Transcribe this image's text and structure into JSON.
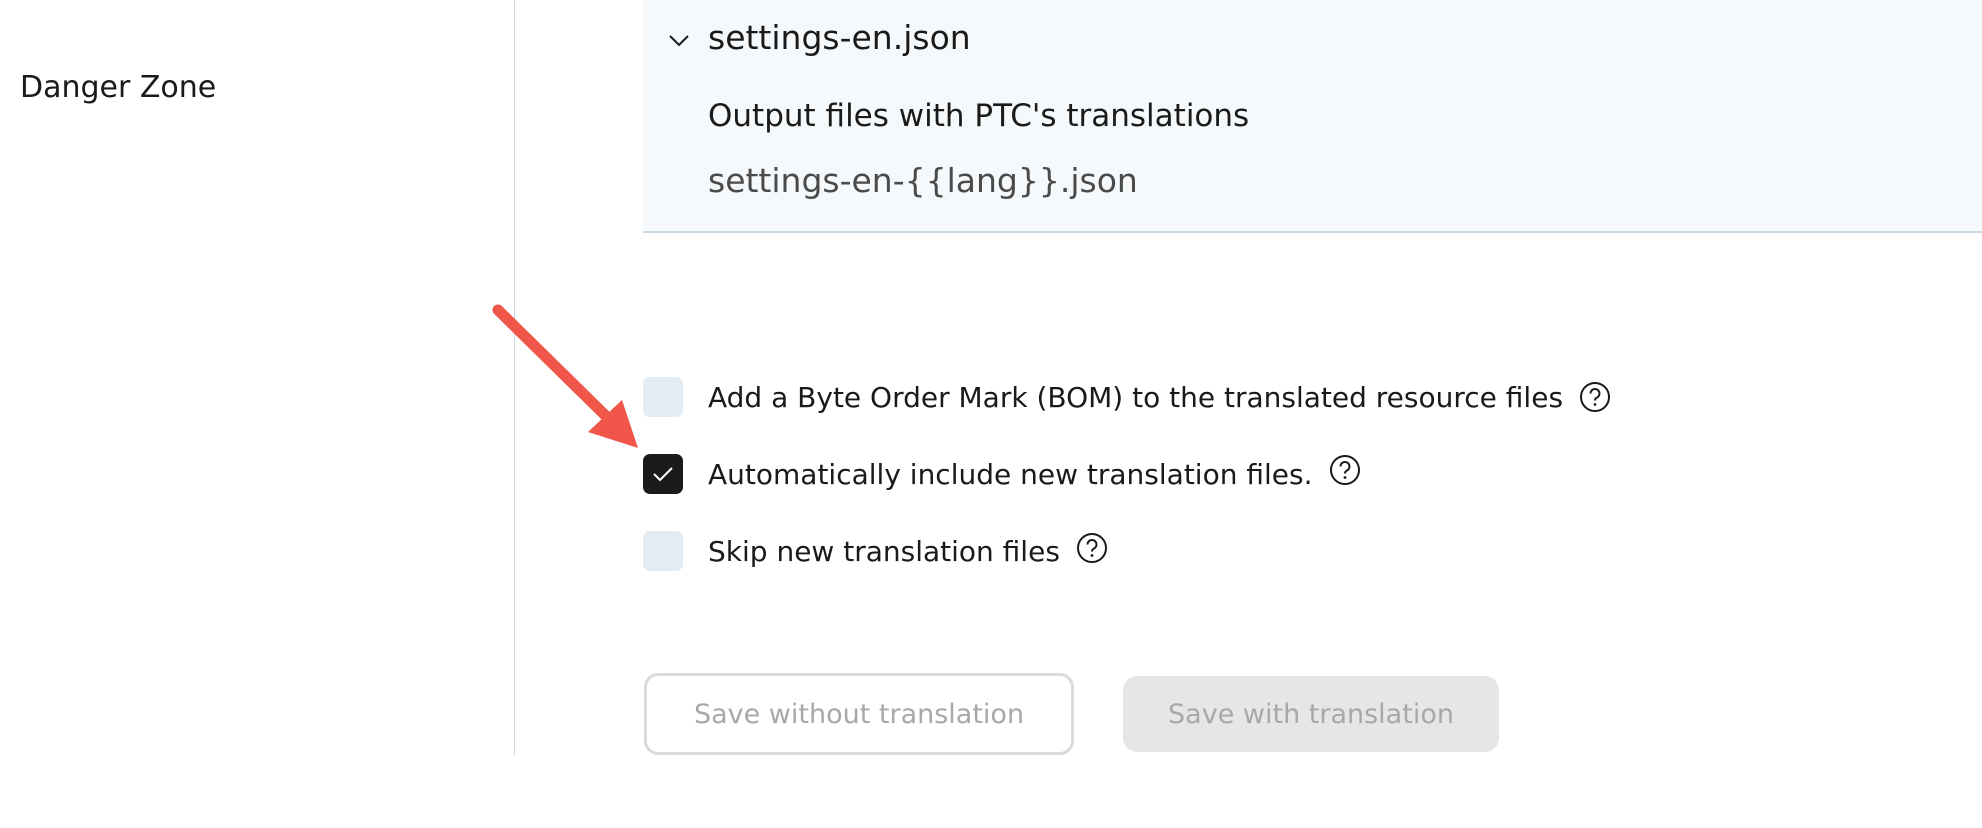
{
  "sidebar": {
    "items": [
      {
        "label": "Danger Zone"
      }
    ]
  },
  "file_panel": {
    "file_name": "settings-en.json",
    "output_label": "Output files with PTC's translations",
    "output_pattern": "settings-en-{{lang}}.json",
    "expand_icon": "chevron-down-icon"
  },
  "options": [
    {
      "label": "Add a Byte Order Mark (BOM) to the translated resource files",
      "checked": false,
      "help_icon": "question-circle-icon"
    },
    {
      "label": "Automatically include new translation files.",
      "checked": true,
      "help_icon": "question-circle-icon"
    },
    {
      "label": "Skip new translation files",
      "checked": false,
      "help_icon": "question-circle-icon"
    }
  ],
  "buttons": {
    "save_without": "Save without translation",
    "save_with": "Save with translation"
  },
  "annotation": {
    "arrow_color": "#f0564a"
  },
  "colors": {
    "panel_background": "#f6f9fb",
    "divider": "#c9dbe7",
    "checkbox_unchecked": "#e2ecf2",
    "checkbox_checked": "#1b1b1b",
    "button_disabled_text": "#a8a8a8"
  }
}
